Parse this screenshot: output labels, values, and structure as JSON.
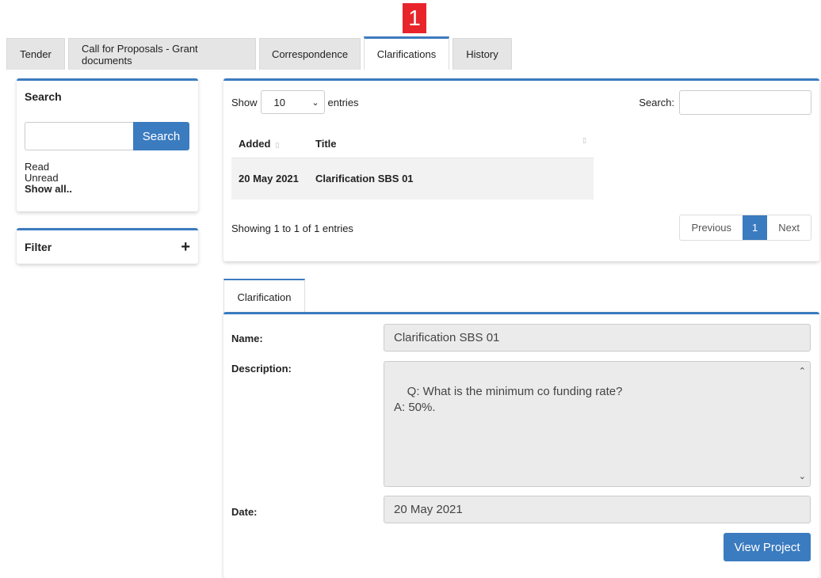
{
  "marker": {
    "number": "1"
  },
  "tabs": [
    {
      "label": "Tender",
      "active": false
    },
    {
      "label": "Call for Proposals - Grant documents",
      "active": false
    },
    {
      "label": "Correspondence",
      "active": false
    },
    {
      "label": "Clarifications",
      "active": true
    },
    {
      "label": "History",
      "active": false
    }
  ],
  "sidebar": {
    "search": {
      "title": "Search",
      "input_value": "",
      "button_label": "Search",
      "links": [
        "Read",
        "Unread",
        "Show all.."
      ]
    },
    "filter": {
      "title": "Filter",
      "toggle": "+"
    }
  },
  "table": {
    "show_label": "Show",
    "entries_value": "10",
    "entries_label": "entries",
    "search_label": "Search:",
    "search_value": "",
    "columns": [
      "Added",
      "Title"
    ],
    "rows": [
      {
        "added": "20 May 2021",
        "title": "Clarification SBS 01"
      }
    ],
    "info": "Showing 1 to 1 of 1 entries",
    "pagination": {
      "previous": "Previous",
      "current": "1",
      "next": "Next"
    }
  },
  "detail": {
    "tab_label": "Clarification",
    "name_label": "Name:",
    "name_value": "Clarification SBS 01",
    "description_label": "Description:",
    "description_value": "Q: What is the minimum co funding rate?\nA: 50%.",
    "date_label": "Date:",
    "date_value": "20 May 2021",
    "view_button": "View Project"
  },
  "colors": {
    "accent": "#3b7bbf",
    "marker": "#e8242b"
  }
}
